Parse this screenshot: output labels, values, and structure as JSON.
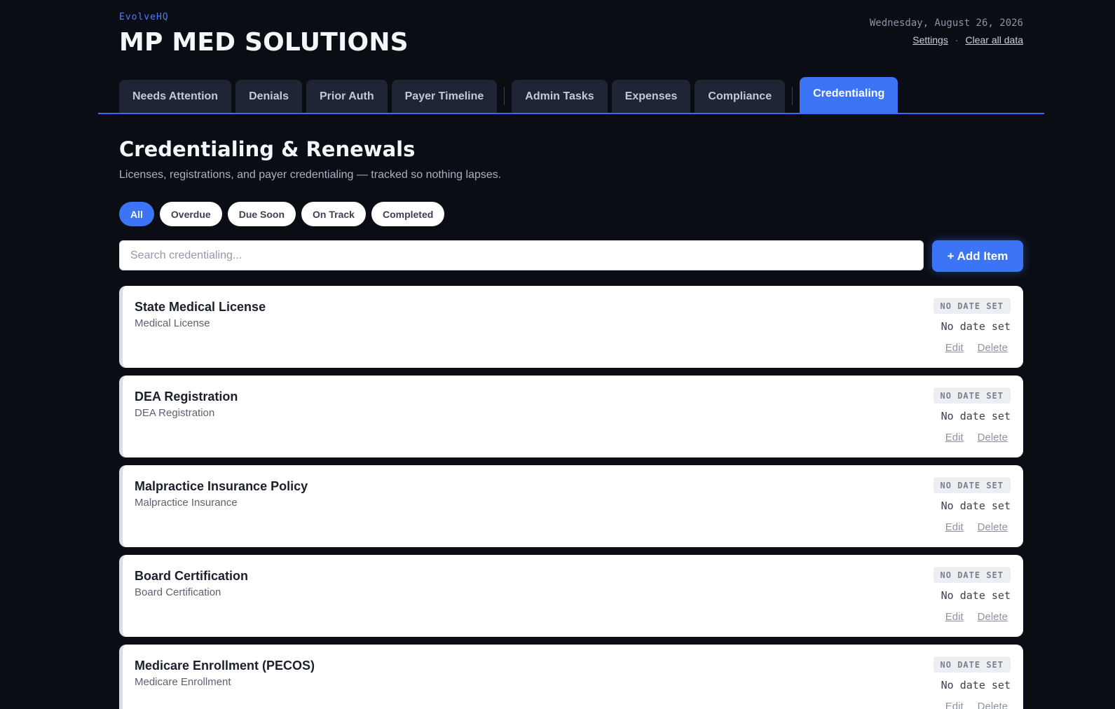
{
  "header": {
    "brand": "EvolveHQ",
    "company": "MP MED SOLUTIONS",
    "date": "Wednesday, August 26, 2026",
    "settings_label": "Settings",
    "separator": "·",
    "clear_label": "Clear all data"
  },
  "tabs": [
    {
      "label": "Needs Attention"
    },
    {
      "label": "Denials"
    },
    {
      "label": "Prior Auth"
    },
    {
      "label": "Payer Timeline"
    },
    {
      "label": "Admin Tasks"
    },
    {
      "label": "Expenses"
    },
    {
      "label": "Compliance"
    },
    {
      "label": "Credentialing"
    }
  ],
  "active_tab": "Credentialing",
  "section": {
    "title": "Credentialing & Renewals",
    "subtitle": "Licenses, registrations, and payer credentialing — tracked so nothing lapses."
  },
  "filters": [
    {
      "label": "All"
    },
    {
      "label": "Overdue"
    },
    {
      "label": "Due Soon"
    },
    {
      "label": "On Track"
    },
    {
      "label": "Completed"
    }
  ],
  "active_filter": "All",
  "search": {
    "placeholder": "Search credentialing..."
  },
  "add_button": "+ Add Item",
  "items": [
    {
      "title": "State Medical License",
      "type": "Medical License",
      "badge": "NO DATE SET",
      "date": "No date set",
      "edit": "Edit",
      "delete": "Delete"
    },
    {
      "title": "DEA Registration",
      "type": "DEA Registration",
      "badge": "NO DATE SET",
      "date": "No date set",
      "edit": "Edit",
      "delete": "Delete"
    },
    {
      "title": "Malpractice Insurance Policy",
      "type": "Malpractice Insurance",
      "badge": "NO DATE SET",
      "date": "No date set",
      "edit": "Edit",
      "delete": "Delete"
    },
    {
      "title": "Board Certification",
      "type": "Board Certification",
      "badge": "NO DATE SET",
      "date": "No date set",
      "edit": "Edit",
      "delete": "Delete"
    },
    {
      "title": "Medicare Enrollment (PECOS)",
      "type": "Medicare Enrollment",
      "badge": "NO DATE SET",
      "date": "No date set",
      "edit": "Edit",
      "delete": "Delete"
    }
  ],
  "colors": {
    "background": "#0a0d14",
    "accent": "#3b74f5",
    "tab_inactive": "#1f2535",
    "brand_text": "#4a7dff"
  }
}
